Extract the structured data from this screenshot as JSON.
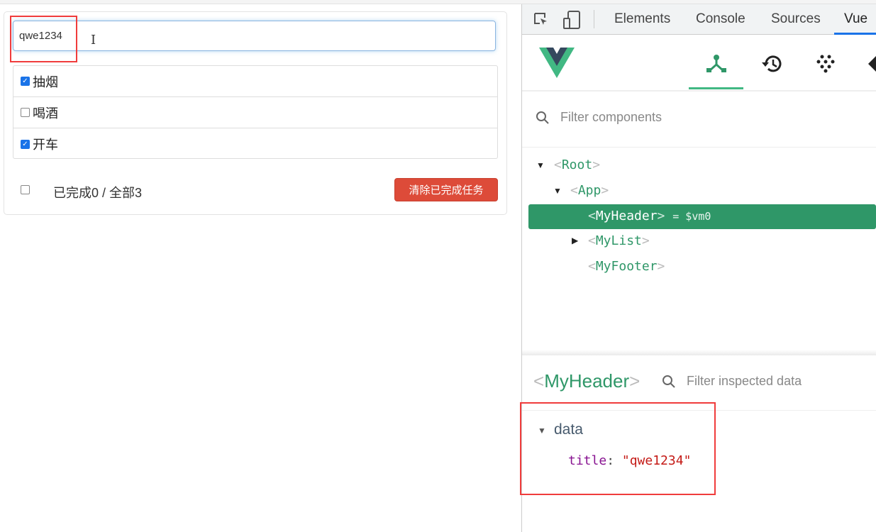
{
  "app": {
    "input_value": "qwe1234",
    "todos": [
      {
        "label": "抽烟",
        "done": true
      },
      {
        "label": "喝酒",
        "done": false
      },
      {
        "label": "开车",
        "done": true
      }
    ],
    "footer_text": "已完成0 / 全部3",
    "clear_button": "清除已完成任务"
  },
  "devtools": {
    "tabs": [
      "Elements",
      "Console",
      "Sources",
      "Vue"
    ],
    "active_tab": "Vue",
    "filter_placeholder": "Filter components",
    "tree": {
      "root": "Root",
      "app": "App",
      "selected": "MyHeader",
      "selected_suffix": "= $vm0",
      "mylist": "MyList",
      "myfooter": "MyFooter"
    },
    "inspector": {
      "component": "MyHeader",
      "filter_placeholder": "Filter inspected data",
      "section": "data",
      "key": "title",
      "value": "\"qwe1234\""
    }
  },
  "colors": {
    "vue_green": "#2f9768",
    "danger": "#dd4b39",
    "annotation": "#f03c3c"
  }
}
